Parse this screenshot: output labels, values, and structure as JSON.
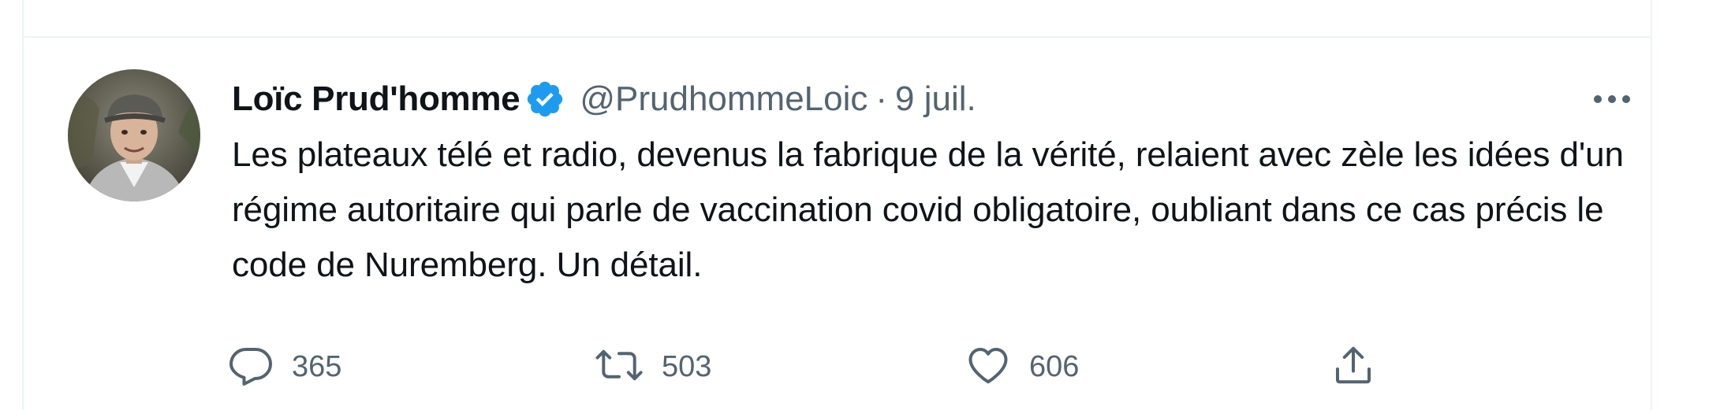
{
  "tweet": {
    "author": {
      "display_name": "Loïc Prud'homme",
      "handle": "@PrudhommeLoic",
      "verified": true
    },
    "separator": "·",
    "date": "9 juil.",
    "text": "Les plateaux télé et radio, devenus la fabrique de la vérité, relaient avec zèle les idées d'un régime autoritaire qui parle de vaccination covid obligatoire, oubliant dans ce cas précis le code de Nuremberg. Un détail.",
    "actions": {
      "replies": "365",
      "retweets": "503",
      "likes": "606"
    }
  },
  "colors": {
    "text_primary": "#0f1419",
    "text_secondary": "#536471",
    "verified_blue": "#1d9bf0",
    "divider": "#eff3f4"
  },
  "icons": {
    "verified": "verified-badge-icon",
    "more": "more-horizontal-icon",
    "reply": "reply-bubble-icon",
    "retweet": "retweet-icon",
    "like": "heart-icon",
    "share": "share-upload-icon"
  }
}
